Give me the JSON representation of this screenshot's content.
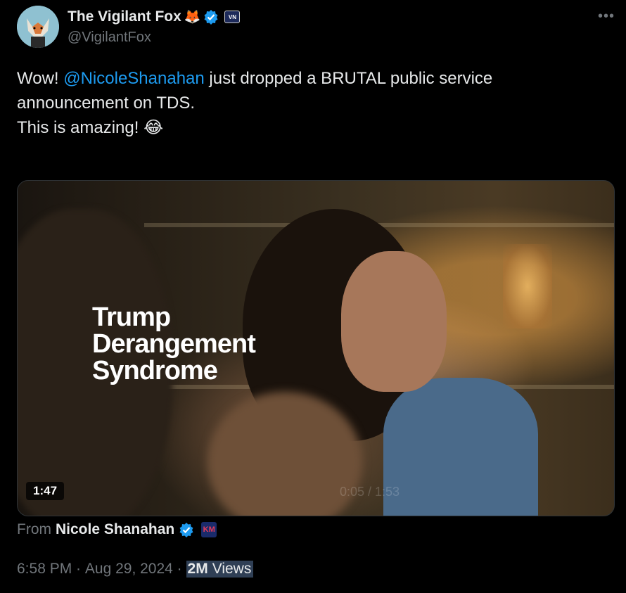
{
  "author": {
    "display_name": "The Vigilant Fox",
    "name_emoji": "🦊",
    "handle": "@VigilantFox",
    "affiliate_badge_text": "VN"
  },
  "more_icon": "more-horizontal-icon",
  "tweet": {
    "line1_prefix": "Wow! ",
    "line1_mention": "@NicoleShanahan",
    "line1_suffix": " just dropped a BRUTAL public service",
    "line2": "announcement on TDS.",
    "line3": "This is amazing! ",
    "line3_emoji": "😂"
  },
  "media": {
    "overlay_lines": [
      "Trump",
      "Derangement",
      "Syndrome"
    ],
    "duration": "1:47",
    "ghost_timestamp": "0:05 / 1:53"
  },
  "source": {
    "from_label": "From",
    "name": "Nicole Shanahan",
    "badge_text": "KM"
  },
  "meta": {
    "time": "6:58 PM",
    "separator": " · ",
    "date": "Aug 29, 2024",
    "views_count": "2M",
    "views_label": "Views"
  },
  "colors": {
    "background": "#000000",
    "text": "#e7e9ea",
    "secondary": "#71767b",
    "accent": "#1d9bf0"
  }
}
